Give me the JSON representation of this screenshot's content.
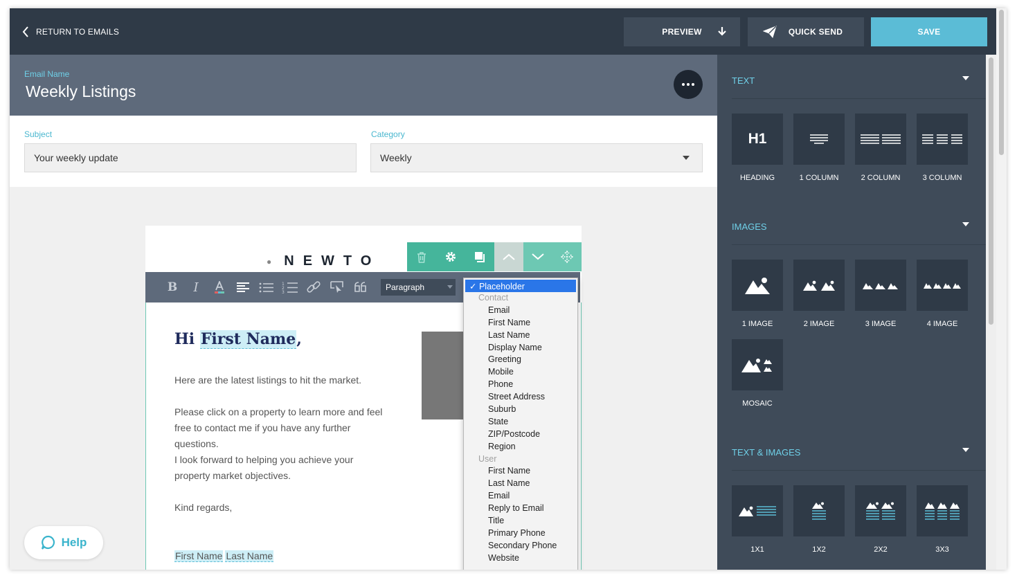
{
  "topbar": {
    "back_label": "RETURN TO EMAILS",
    "preview_label": "PREVIEW",
    "quicksend_label": "QUICK SEND",
    "save_label": "SAVE"
  },
  "email": {
    "name_label": "Email Name",
    "name_value": "Weekly Listings",
    "subject_label": "Subject",
    "subject_value": "Your weekly update",
    "category_label": "Category",
    "category_value": "Weekly"
  },
  "editor": {
    "logo_text": "NEWTO",
    "paragraph_select": "Paragraph",
    "greeting_prefix": "Hi ",
    "greeting_placeholder": "First Name",
    "greeting_suffix": ",",
    "paragraph_1": "Here are the latest listings to hit the market.",
    "paragraph_2": "Please click on a property to learn more and feel free to contact me if you have any further questions.",
    "paragraph_3": "I look forward to helping you achieve your property market objectives.",
    "paragraph_4": "Kind regards,",
    "signature_first": "First Name",
    "signature_last": "Last Name"
  },
  "placeholder_dropdown": {
    "selected": "Placeholder",
    "groups": [
      {
        "label": "Contact",
        "items": [
          "Email",
          "First Name",
          "Last Name",
          "Display Name",
          "Greeting",
          "Mobile",
          "Phone",
          "Street Address",
          "Suburb",
          "State",
          "ZIP/Postcode",
          "Region"
        ]
      },
      {
        "label": "User",
        "items": [
          "First Name",
          "Last Name",
          "Email",
          "Reply to Email",
          "Title",
          "Primary Phone",
          "Secondary Phone",
          "Website"
        ]
      }
    ]
  },
  "help": {
    "label": "Help"
  },
  "blocks": {
    "text": {
      "title": "TEXT",
      "tiles": [
        {
          "label": "HEADING",
          "icon": "h1-icon",
          "glyph": "H1"
        },
        {
          "label": "1 COLUMN",
          "icon": "one-column-icon"
        },
        {
          "label": "2 COLUMN",
          "icon": "two-column-icon"
        },
        {
          "label": "3 COLUMN",
          "icon": "three-column-icon"
        }
      ]
    },
    "images": {
      "title": "IMAGES",
      "tiles": [
        {
          "label": "1 IMAGE",
          "icon": "one-image-icon"
        },
        {
          "label": "2 IMAGE",
          "icon": "two-image-icon"
        },
        {
          "label": "3 IMAGE",
          "icon": "three-image-icon"
        },
        {
          "label": "4 IMAGE",
          "icon": "four-image-icon"
        },
        {
          "label": "MOSAIC",
          "icon": "mosaic-icon"
        }
      ]
    },
    "text_images": {
      "title": "TEXT & IMAGES",
      "tiles": [
        {
          "label": "1X1",
          "icon": "1x1-icon"
        },
        {
          "label": "1X2",
          "icon": "1x2-icon"
        },
        {
          "label": "2X2",
          "icon": "2x2-icon"
        },
        {
          "label": "3X3",
          "icon": "3x3-icon"
        }
      ]
    }
  },
  "colors": {
    "topbar": "#2f3a47",
    "accent": "#5bbcd6",
    "panel": "#3f4b59",
    "block_toolbar": "#45b59b",
    "placeholder_highlight": "#cdeef6"
  }
}
